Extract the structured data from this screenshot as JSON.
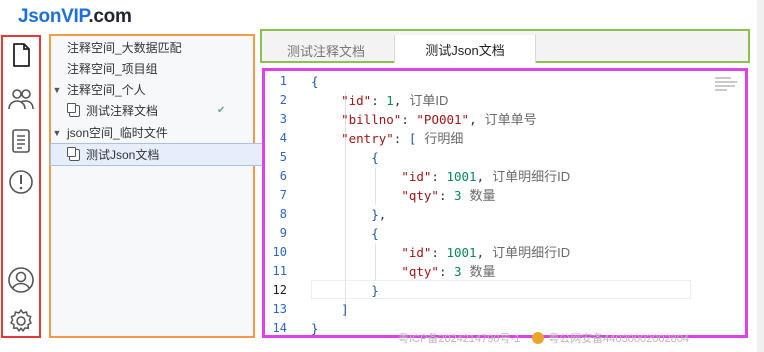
{
  "app": {
    "logo_part1": "JsonVIP",
    "logo_part2": ".com"
  },
  "activity_bar": {
    "icons": [
      "file-icon",
      "users-icon",
      "document-icon",
      "alert-icon",
      "account-icon",
      "settings-icon"
    ]
  },
  "sidebar": {
    "items": [
      {
        "label": "注释空间_大数据匹配"
      },
      {
        "label": "注释空间_项目组"
      },
      {
        "label": "注释空间_个人"
      },
      {
        "label": "测试注释文档"
      },
      {
        "label": "json空间_临时文件"
      },
      {
        "label": "测试Json文档"
      }
    ]
  },
  "tabs": [
    "测试注释文档",
    "测试Json文档"
  ],
  "editor": {
    "line_numbers": [
      "1",
      "2",
      "3",
      "4",
      "5",
      "6",
      "7",
      "8",
      "9",
      "10",
      "11",
      "12",
      "13",
      "14"
    ],
    "comments": {
      "id": "订单ID",
      "billno": "订单单号",
      "entry": "行明细",
      "entry_id": "订单明细行ID",
      "qty": "数量"
    },
    "values": {
      "id": "1",
      "billno": "\"PO001\"",
      "entry_id": "1001",
      "qty": "3"
    }
  },
  "footer": {
    "icp": "粤ICP备2024214790号-1",
    "police": "粤公网安备44030002002804"
  },
  "colors": {
    "activity_border": "#e53935",
    "sidebar_border": "#f2994a",
    "tabbar_border": "#8bc34a",
    "editor_border": "#e040e8",
    "logo_blue": "#1e6fd9"
  }
}
